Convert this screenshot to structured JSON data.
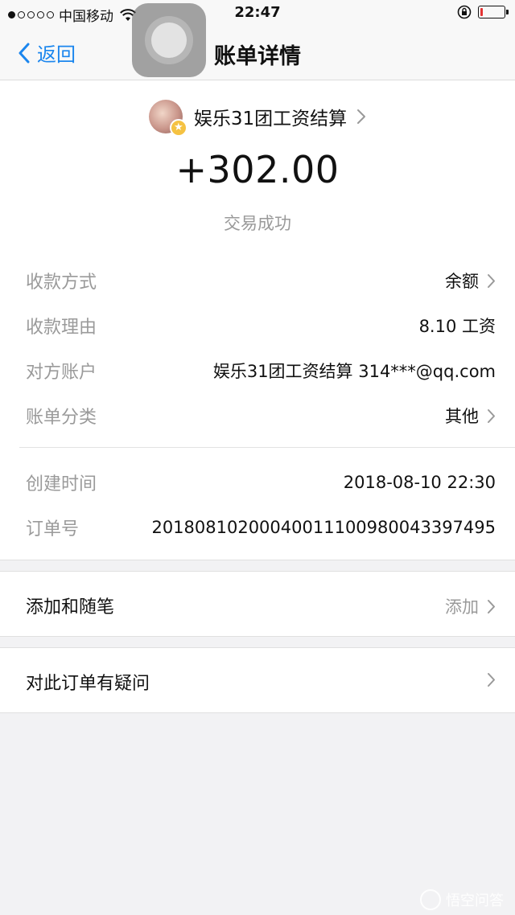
{
  "status_bar": {
    "carrier": "中国移动",
    "time": "22:47",
    "battery_level": 0.1,
    "battery_color": "#e33333"
  },
  "nav": {
    "back_label": "返回",
    "title": "账单详情"
  },
  "payee": {
    "name": "娱乐31团工资结算",
    "avatar_badge_icon": "star-badge-icon"
  },
  "amount": "+302.00",
  "status": "交易成功",
  "details": [
    {
      "label": "收款方式",
      "value": "余额",
      "chevron": true
    },
    {
      "label": "收款理由",
      "value": "8.10 工资",
      "chevron": false
    },
    {
      "label": "对方账户",
      "value": "娱乐31团工资结算 314***@qq.com",
      "chevron": false
    },
    {
      "label": "账单分类",
      "value": "其他",
      "chevron": true
    }
  ],
  "meta": [
    {
      "label": "创建时间",
      "value": "2018-08-10 22:30"
    },
    {
      "label": "订单号",
      "value": "20180810200040011100980043397495"
    }
  ],
  "notes": {
    "label": "添加和随笔",
    "action": "添加"
  },
  "question": {
    "label": "对此订单有疑问"
  },
  "watermark": "悟空问答",
  "colors": {
    "accent": "#1b86ee",
    "secondary_text": "#9a9a9a",
    "background": "#f2f2f4"
  }
}
